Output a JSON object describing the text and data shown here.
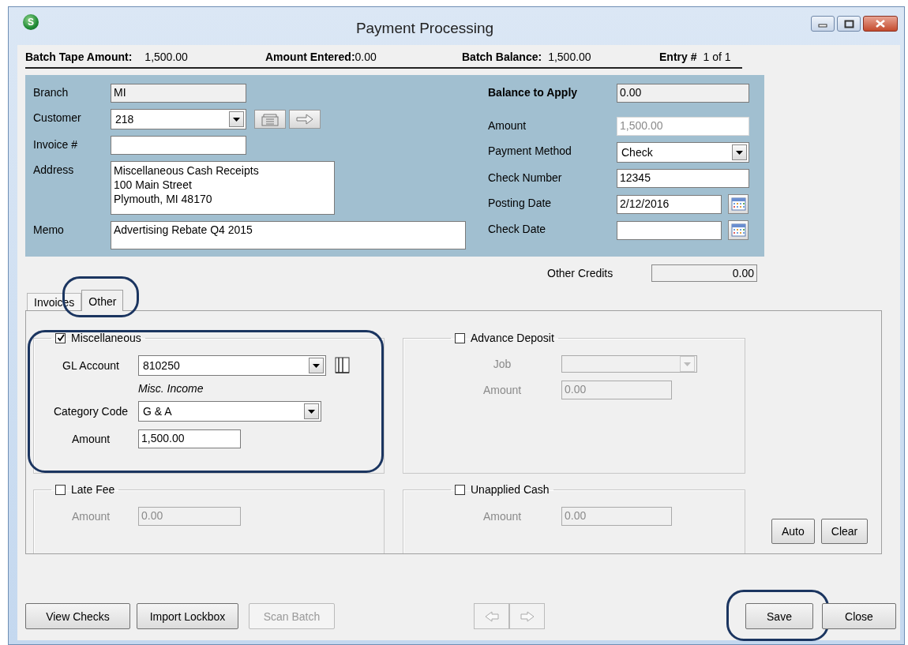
{
  "window": {
    "title": "Payment Processing",
    "app_badge": "S"
  },
  "summary": [
    {
      "label": "Batch Tape Amount:",
      "value": "1,500.00"
    },
    {
      "label": "Amount Entered:",
      "value": "0.00"
    },
    {
      "label": "Batch Balance:",
      "value": "1,500.00"
    },
    {
      "label": "Entry #",
      "value": "1 of 1"
    }
  ],
  "customer_panel": {
    "left": [
      {
        "kind": "readonly",
        "label": "Branch",
        "value": "MI"
      },
      {
        "kind": "combo",
        "label": "Customer",
        "value": "218",
        "tools": [
          {
            "kind": "tray"
          },
          {
            "kind": "arrow"
          }
        ]
      },
      {
        "kind": "text",
        "label": "Invoice #"
      },
      {
        "kind": "multiline",
        "label": "Address",
        "lines": [
          "Miscellaneous Cash Receipts",
          "100 Main Street",
          "Plymouth, MI  48170"
        ]
      },
      {
        "kind": "memo",
        "label": "Memo",
        "value": "Advertising Rebate Q4 2015"
      }
    ],
    "right": [
      {
        "kind": "readonly",
        "label": "Balance to Apply",
        "value": "0.00",
        "disabled": false
      },
      {
        "kind": "text",
        "label": "Amount",
        "value": "1,500.00",
        "disabled": true
      },
      {
        "kind": "combo",
        "label": "Payment Method",
        "value": "Check",
        "disabled": false
      },
      {
        "kind": "text",
        "label": "Check Number",
        "value": "12345",
        "disabled": false
      },
      {
        "kind": "date",
        "label": "Posting Date",
        "value": "2/12/2016",
        "disabled": false
      },
      {
        "kind": "date",
        "label": "Check Date",
        "disabled": false
      }
    ]
  },
  "other_credits": {
    "label": "Other Credits",
    "value": "0.00"
  },
  "tabs": [
    {
      "label": "Invoices",
      "selected": false,
      "highlighted": false
    },
    {
      "label": "Other",
      "selected": true,
      "highlighted": true
    }
  ],
  "groups": [
    {
      "title": "Miscellaneous",
      "checked": true,
      "highlighted": true,
      "fields": [
        {
          "kind": "combo",
          "label": "GL Account",
          "value": "810250",
          "lookup": true,
          "disabled": false
        },
        {
          "kind": "note",
          "text": "Misc. Income",
          "disabled": false
        },
        {
          "kind": "combo",
          "label": "Category Code",
          "value": "G & A",
          "disabled": false
        },
        {
          "kind": "text",
          "label": "Amount",
          "value": "1,500.00",
          "disabled": false
        }
      ]
    },
    {
      "title": "Advance Deposit",
      "checked": false,
      "highlighted": false,
      "fields": [
        {
          "kind": "combo",
          "label": "Job",
          "disabled": true
        },
        {
          "kind": "text",
          "label": "Amount",
          "value": "0.00",
          "disabled": true
        }
      ]
    },
    {
      "title": "Late Fee",
      "checked": false,
      "highlighted": false,
      "fields": [
        {
          "kind": "text",
          "label": "Amount",
          "value": "0.00",
          "disabled": true
        }
      ]
    },
    {
      "title": "Unapplied Cash",
      "checked": false,
      "highlighted": false,
      "fields": [
        {
          "kind": "text",
          "label": "Amount",
          "value": "0.00",
          "disabled": true
        }
      ]
    }
  ],
  "side_buttons": [
    {
      "label": "Auto"
    },
    {
      "label": "Clear"
    }
  ],
  "footer": {
    "left_buttons": [
      {
        "label": "View Checks",
        "disabled": false
      },
      {
        "label": "Import Lockbox",
        "disabled": false
      },
      {
        "label": "Scan Batch",
        "disabled": true
      }
    ],
    "nav_buttons": [
      {
        "kind": "back"
      },
      {
        "kind": "forward"
      }
    ],
    "right_buttons": [
      {
        "label": "Save",
        "highlighted": true
      },
      {
        "label": "Close",
        "highlighted": false
      }
    ]
  }
}
